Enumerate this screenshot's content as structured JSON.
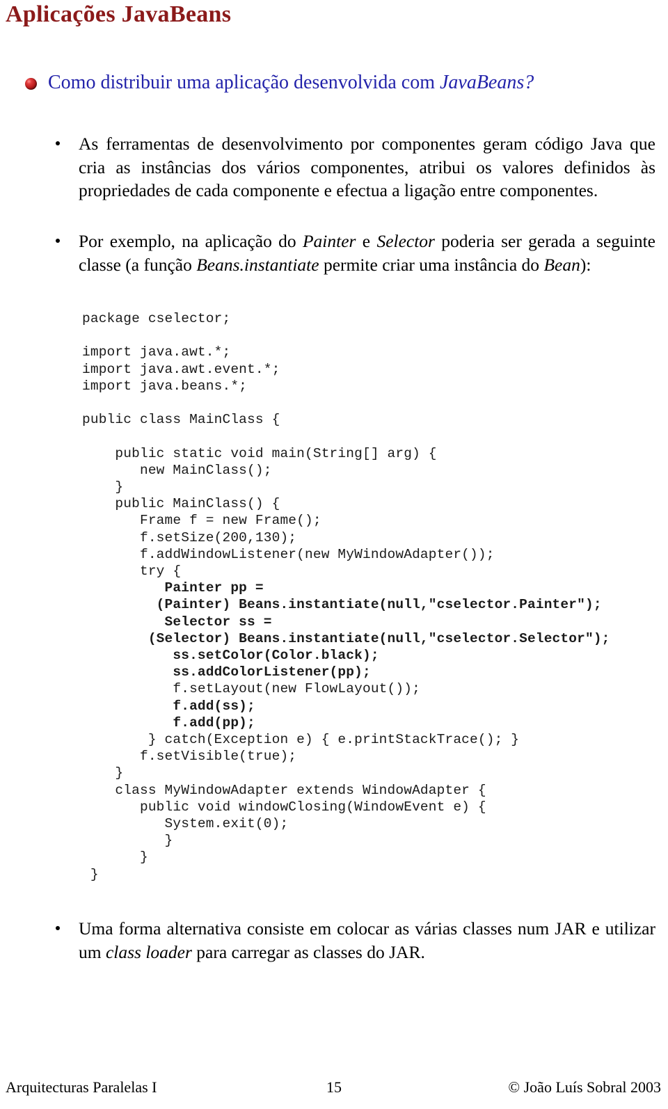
{
  "slide": {
    "title": "Aplicações JavaBeans",
    "title_color": "#8B1A1A",
    "heading_color": "#2222AA",
    "heading": {
      "text_before_italic": "Como distribuir uma aplicação desenvolvida com ",
      "italic_text": "JavaBeans?",
      "bullet_icon": "red-sphere-bullet-icon"
    },
    "paragraphs": [
      {
        "id": "para-1",
        "bullet_icon": "round-bullet-icon",
        "runs": [
          {
            "text": "As ferramentas de desenvolvimento por componentes geram código Java que cria as instâncias dos vários componentes, atribui os valores definidos às propriedades de cada componente e efectua a ligação entre componentes.",
            "style": "normal"
          }
        ]
      },
      {
        "id": "para-2",
        "bullet_icon": "round-bullet-icon",
        "runs": [
          {
            "text": "Por exemplo, na aplicação do ",
            "style": "normal"
          },
          {
            "text": "Painter",
            "style": "italic"
          },
          {
            "text": " e ",
            "style": "normal"
          },
          {
            "text": "Selector",
            "style": "italic"
          },
          {
            "text": " poderia ser gerada a seguinte classe (a função ",
            "style": "normal"
          },
          {
            "text": "Beans.instantiate",
            "style": "italic"
          },
          {
            "text": " permite criar uma instância do ",
            "style": "normal"
          },
          {
            "text": "Bean",
            "style": "italic"
          },
          {
            "text": "):",
            "style": "normal"
          }
        ]
      },
      {
        "id": "para-3",
        "bullet_icon": "round-bullet-icon",
        "runs": [
          {
            "text": "Uma forma alternativa consiste em colocar as várias classes num JAR e utilizar um ",
            "style": "normal"
          },
          {
            "text": "class loader",
            "style": "italic"
          },
          {
            "text": " para carregar as classes do JAR.",
            "style": "normal"
          }
        ]
      }
    ],
    "code": {
      "language": "java",
      "lines": [
        {
          "text": "package cselector;",
          "bold": false
        },
        {
          "text": "",
          "bold": false
        },
        {
          "text": "import java.awt.*;",
          "bold": false
        },
        {
          "text": "import java.awt.event.*;",
          "bold": false
        },
        {
          "text": "import java.beans.*;",
          "bold": false
        },
        {
          "text": "",
          "bold": false
        },
        {
          "text": "public class MainClass {",
          "bold": false
        },
        {
          "text": "",
          "bold": false
        },
        {
          "text": "    public static void main(String[] arg) {",
          "bold": false
        },
        {
          "text": "       new MainClass();",
          "bold": false
        },
        {
          "text": "    }",
          "bold": false
        },
        {
          "text": "    public MainClass() {",
          "bold": false
        },
        {
          "text": "       Frame f = new Frame();",
          "bold": false
        },
        {
          "text": "       f.setSize(200,130);",
          "bold": false
        },
        {
          "text": "       f.addWindowListener(new MyWindowAdapter());",
          "bold": false
        },
        {
          "text": "       try {",
          "bold": false
        },
        {
          "text": "          Painter pp =",
          "bold": true
        },
        {
          "text": "         (Painter) Beans.instantiate(null,\"cselector.Painter\");",
          "bold": true
        },
        {
          "text": "          Selector ss =",
          "bold": true
        },
        {
          "text": "        (Selector) Beans.instantiate(null,\"cselector.Selector\");",
          "bold": true
        },
        {
          "text": "           ss.setColor(Color.black);",
          "bold": true
        },
        {
          "text": "           ss.addColorListener(pp);",
          "bold": true
        },
        {
          "text": "           f.setLayout(new FlowLayout());",
          "bold": false
        },
        {
          "text": "           f.add(ss);",
          "bold": true
        },
        {
          "text": "           f.add(pp);",
          "bold": true
        },
        {
          "text": "        } catch(Exception e) { e.printStackTrace(); }",
          "bold": false
        },
        {
          "text": "       f.setVisible(true);",
          "bold": false
        },
        {
          "text": "    }",
          "bold": false
        },
        {
          "text": "    class MyWindowAdapter extends WindowAdapter {",
          "bold": false
        },
        {
          "text": "       public void windowClosing(WindowEvent e) {",
          "bold": false
        },
        {
          "text": "          System.exit(0);",
          "bold": false
        },
        {
          "text": "          }",
          "bold": false
        },
        {
          "text": "       }",
          "bold": false
        },
        {
          "text": " }",
          "bold": false
        }
      ]
    },
    "footer": {
      "left": "Arquitecturas Paralelas I",
      "page_number": "15",
      "right": "© João Luís Sobral 2003"
    }
  }
}
